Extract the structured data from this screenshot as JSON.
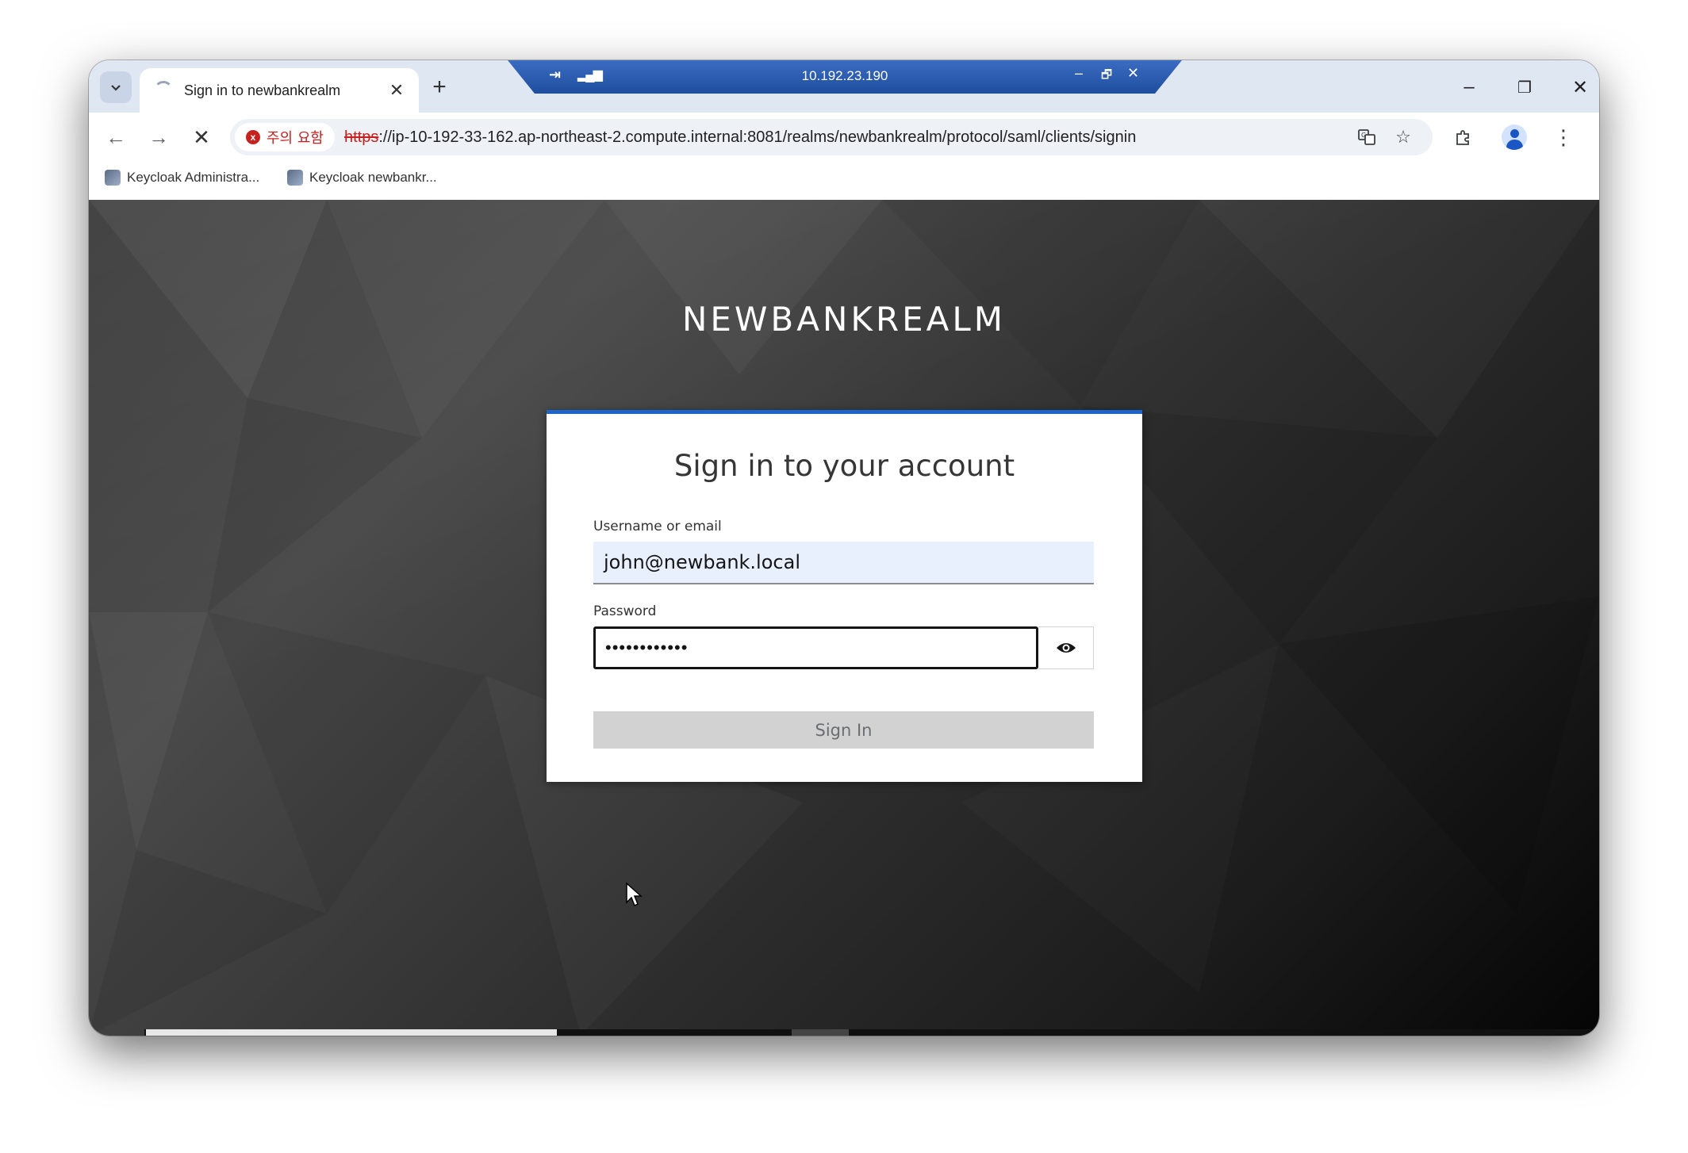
{
  "browser": {
    "tab_title": "Sign in to newbankrealm",
    "tab_close": "✕",
    "new_tab": "+",
    "rdp": {
      "ip": "10.192.23.190",
      "min": "–",
      "restore": "🗗",
      "close": "✕"
    },
    "window_controls": {
      "minimize": "–",
      "restore": "❐",
      "close": "✕"
    },
    "security_chip": {
      "label": "주의 요함",
      "icon": "x"
    },
    "url_scheme": "https",
    "url_rest": "://ip-10-192-33-162.ap-northeast-2.compute.internal:8081/realms/newbankrealm/protocol/saml/clients/signin",
    "bookmarks": [
      {
        "label": "Keycloak Administra..."
      },
      {
        "label": "Keycloak newbankr..."
      }
    ]
  },
  "page": {
    "realm_title": "NEWBANKREALM",
    "card_title": "Sign in to your account",
    "username_label": "Username or email",
    "username_value": "john@newbank.local",
    "password_label": "Password",
    "password_value": "••••••••••••",
    "sign_in_label": "Sign In"
  },
  "colors": {
    "accent": "#1e65c9",
    "warning": "#c5221f",
    "autofill_bg": "#e8f0fe"
  }
}
